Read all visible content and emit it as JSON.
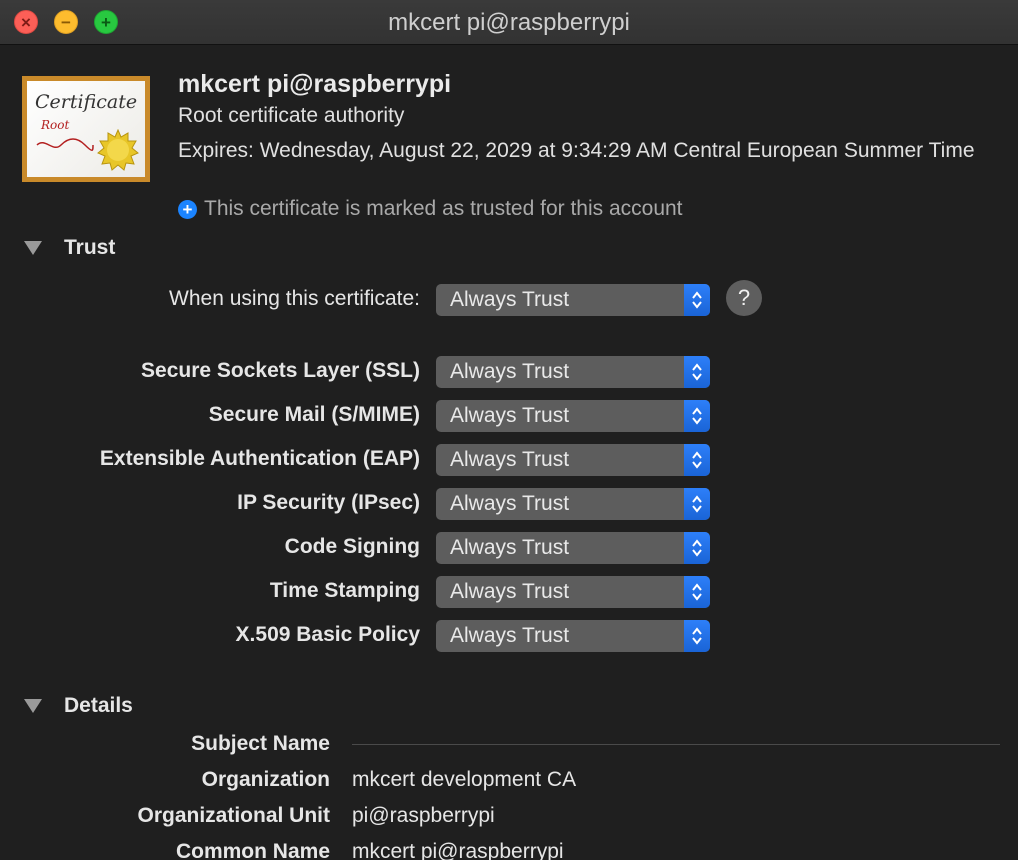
{
  "window": {
    "title": "mkcert pi@raspberrypi",
    "controls": {
      "close": "×",
      "minimize": "−",
      "zoom": "+"
    }
  },
  "header": {
    "cert_image": {
      "word": "Certificate",
      "subword": "Root"
    },
    "name": "mkcert pi@raspberrypi",
    "kind": "Root certificate authority",
    "expires": "Expires: Wednesday, August 22, 2029 at 9:34:29 AM Central European Summer Time",
    "trusted_note": "This certificate is marked as trusted for this account",
    "trusted_icon": "plus-circle-icon"
  },
  "trust": {
    "section_label": "Trust",
    "when_using_label": "When using this certificate:",
    "when_using_value": "Always Trust",
    "help_label": "?",
    "policies": [
      {
        "label": "Secure Sockets Layer (SSL)",
        "value": "Always Trust"
      },
      {
        "label": "Secure Mail (S/MIME)",
        "value": "Always Trust"
      },
      {
        "label": "Extensible Authentication (EAP)",
        "value": "Always Trust"
      },
      {
        "label": "IP Security (IPsec)",
        "value": "Always Trust"
      },
      {
        "label": "Code Signing",
        "value": "Always Trust"
      },
      {
        "label": "Time Stamping",
        "value": "Always Trust"
      },
      {
        "label": "X.509 Basic Policy",
        "value": "Always Trust"
      }
    ]
  },
  "details": {
    "section_label": "Details",
    "subject_name_label": "Subject Name",
    "rows": [
      {
        "label": "Organization",
        "value": "mkcert development CA"
      },
      {
        "label": "Organizational Unit",
        "value": "pi@raspberrypi"
      },
      {
        "label": "Common Name",
        "value": "mkcert pi@raspberrypi"
      }
    ]
  },
  "colors": {
    "accent": "#1a64d6",
    "popup_bg": "#5d5d5d",
    "window_bg": "#1f1f1f"
  }
}
